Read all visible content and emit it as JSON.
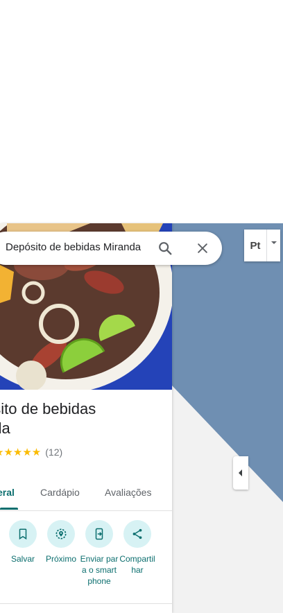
{
  "search": {
    "query": "Depósito de bebidas Miranda"
  },
  "place": {
    "title": "ósito de bebidas\nnda",
    "title_line1": "ósito de bebidas",
    "title_line2": "nda",
    "stars": "★★★★★",
    "rating_value": 5,
    "review_count": "(12)"
  },
  "tabs": [
    {
      "label": "eral",
      "active": true
    },
    {
      "label": "Cardápio",
      "active": false
    },
    {
      "label": "Avaliações",
      "active": false
    }
  ],
  "actions": [
    {
      "label": "Salvar",
      "icon": "bookmark-icon"
    },
    {
      "label": "Próximo",
      "icon": "nearby-icon"
    },
    {
      "label": "Enviar para o smartphone",
      "icon": "send-to-phone-icon"
    },
    {
      "label": "Compartilhar",
      "icon": "share-icon"
    }
  ],
  "map_controls": {
    "layer_label": "Pt"
  },
  "colors": {
    "accent": "#0b6e6e",
    "action_bg": "#d7f2f4",
    "map_water": "#6f8fb2",
    "star": "#fbbc04"
  }
}
